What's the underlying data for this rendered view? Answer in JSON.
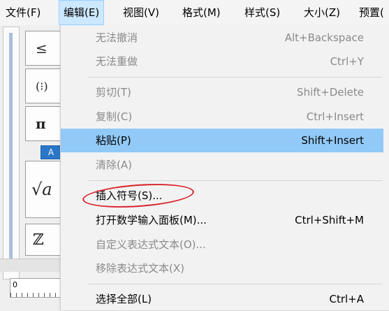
{
  "menubar": {
    "items": [
      "文件(F)",
      "编辑(E)",
      "视图(V)",
      "格式(M)",
      "样式(S)",
      "大小(Z)",
      "预置("
    ]
  },
  "palette": {
    "symbols": [
      "≤",
      "(⁝)",
      "π",
      "√a",
      "ℤ"
    ],
    "tag": "A",
    "ruler_label": "0"
  },
  "edit_menu": {
    "items": [
      {
        "label": "无法撤消",
        "shortcut": "Alt+Backspace",
        "enabled": false
      },
      {
        "label": "无法重做",
        "shortcut": "Ctrl+Y",
        "enabled": false
      },
      {
        "label": "剪切(T)",
        "shortcut": "Shift+Delete",
        "enabled": false
      },
      {
        "label": "复制(C)",
        "shortcut": "Ctrl+Insert",
        "enabled": false
      },
      {
        "label": "粘贴(P)",
        "shortcut": "Shift+Insert",
        "enabled": true,
        "highlighted": true
      },
      {
        "label": "清除(A)",
        "shortcut": "",
        "enabled": false
      },
      {
        "label": "插入符号(S)...",
        "shortcut": "",
        "enabled": true,
        "annotated": true
      },
      {
        "label": "打开数学输入面板(M)...",
        "shortcut": "Ctrl+Shift+M",
        "enabled": true
      },
      {
        "label": "自定义表达式文本(O)...",
        "shortcut": "",
        "enabled": false
      },
      {
        "label": "移除表达式文本(X)",
        "shortcut": "",
        "enabled": false
      },
      {
        "label": "选择全部(L)",
        "shortcut": "Ctrl+A",
        "enabled": true
      }
    ]
  },
  "colors": {
    "highlight": "#91c9f7",
    "annotation": "#d9232b",
    "active_menu": "#cce8ff"
  }
}
